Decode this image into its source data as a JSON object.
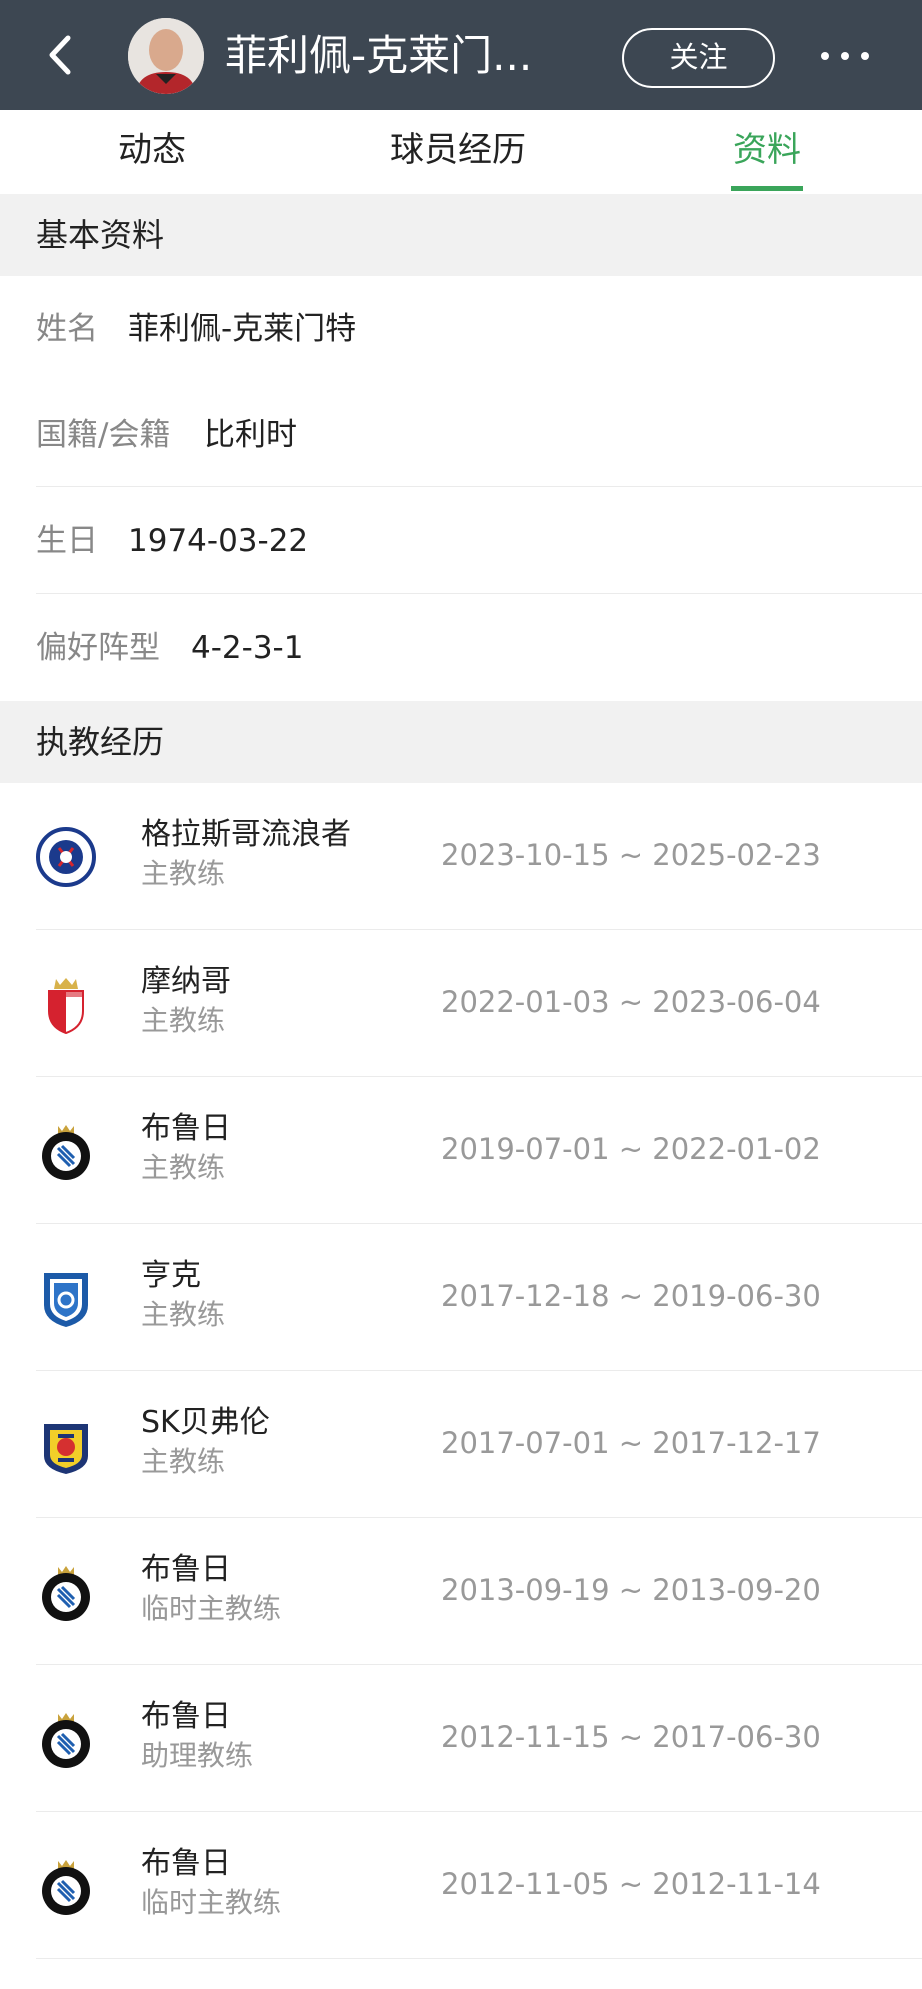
{
  "header": {
    "title": "菲利佩-克莱门...",
    "follow_label": "关注",
    "back_icon": "chevron-left-icon",
    "more_icon": "more-dots-icon",
    "background": "#3d4752"
  },
  "tabs": [
    {
      "label": "动态",
      "active": false
    },
    {
      "label": "球员经历",
      "active": false
    },
    {
      "label": "资料",
      "active": true
    }
  ],
  "accent_color": "#3aa55a",
  "basic_info": {
    "title": "基本资料",
    "rows": [
      {
        "label": "姓名",
        "value": "菲利佩-克莱门特"
      },
      {
        "label": "国籍/会籍",
        "value": "比利时"
      },
      {
        "label": "生日",
        "value": "1974-03-22"
      },
      {
        "label": "偏好阵型",
        "value": "4-2-3-1"
      }
    ]
  },
  "coaching": {
    "title": "执教经历",
    "rows": [
      {
        "club": "格拉斯哥流浪者",
        "role": "主教练",
        "dates": "2023-10-15 ~ 2025-02-23",
        "logo": "rangers-crest-icon"
      },
      {
        "club": "摩纳哥",
        "role": "主教练",
        "dates": "2022-01-03 ~ 2023-06-04",
        "logo": "monaco-crest-icon"
      },
      {
        "club": "布鲁日",
        "role": "主教练",
        "dates": "2019-07-01 ~ 2022-01-02",
        "logo": "club-brugge-crest-icon"
      },
      {
        "club": "亨克",
        "role": "主教练",
        "dates": "2017-12-18 ~ 2019-06-30",
        "logo": "genk-crest-icon"
      },
      {
        "club": "SK贝弗伦",
        "role": "主教练",
        "dates": "2017-07-01 ~ 2017-12-17",
        "logo": "beveren-crest-icon"
      },
      {
        "club": "布鲁日",
        "role": "临时主教练",
        "dates": "2013-09-19 ~ 2013-09-20",
        "logo": "club-brugge-crest-icon"
      },
      {
        "club": "布鲁日",
        "role": "助理教练",
        "dates": "2012-11-15 ~ 2017-06-30",
        "logo": "club-brugge-crest-icon"
      },
      {
        "club": "布鲁日",
        "role": "临时主教练",
        "dates": "2012-11-05 ~ 2012-11-14",
        "logo": "club-brugge-crest-icon"
      }
    ]
  }
}
